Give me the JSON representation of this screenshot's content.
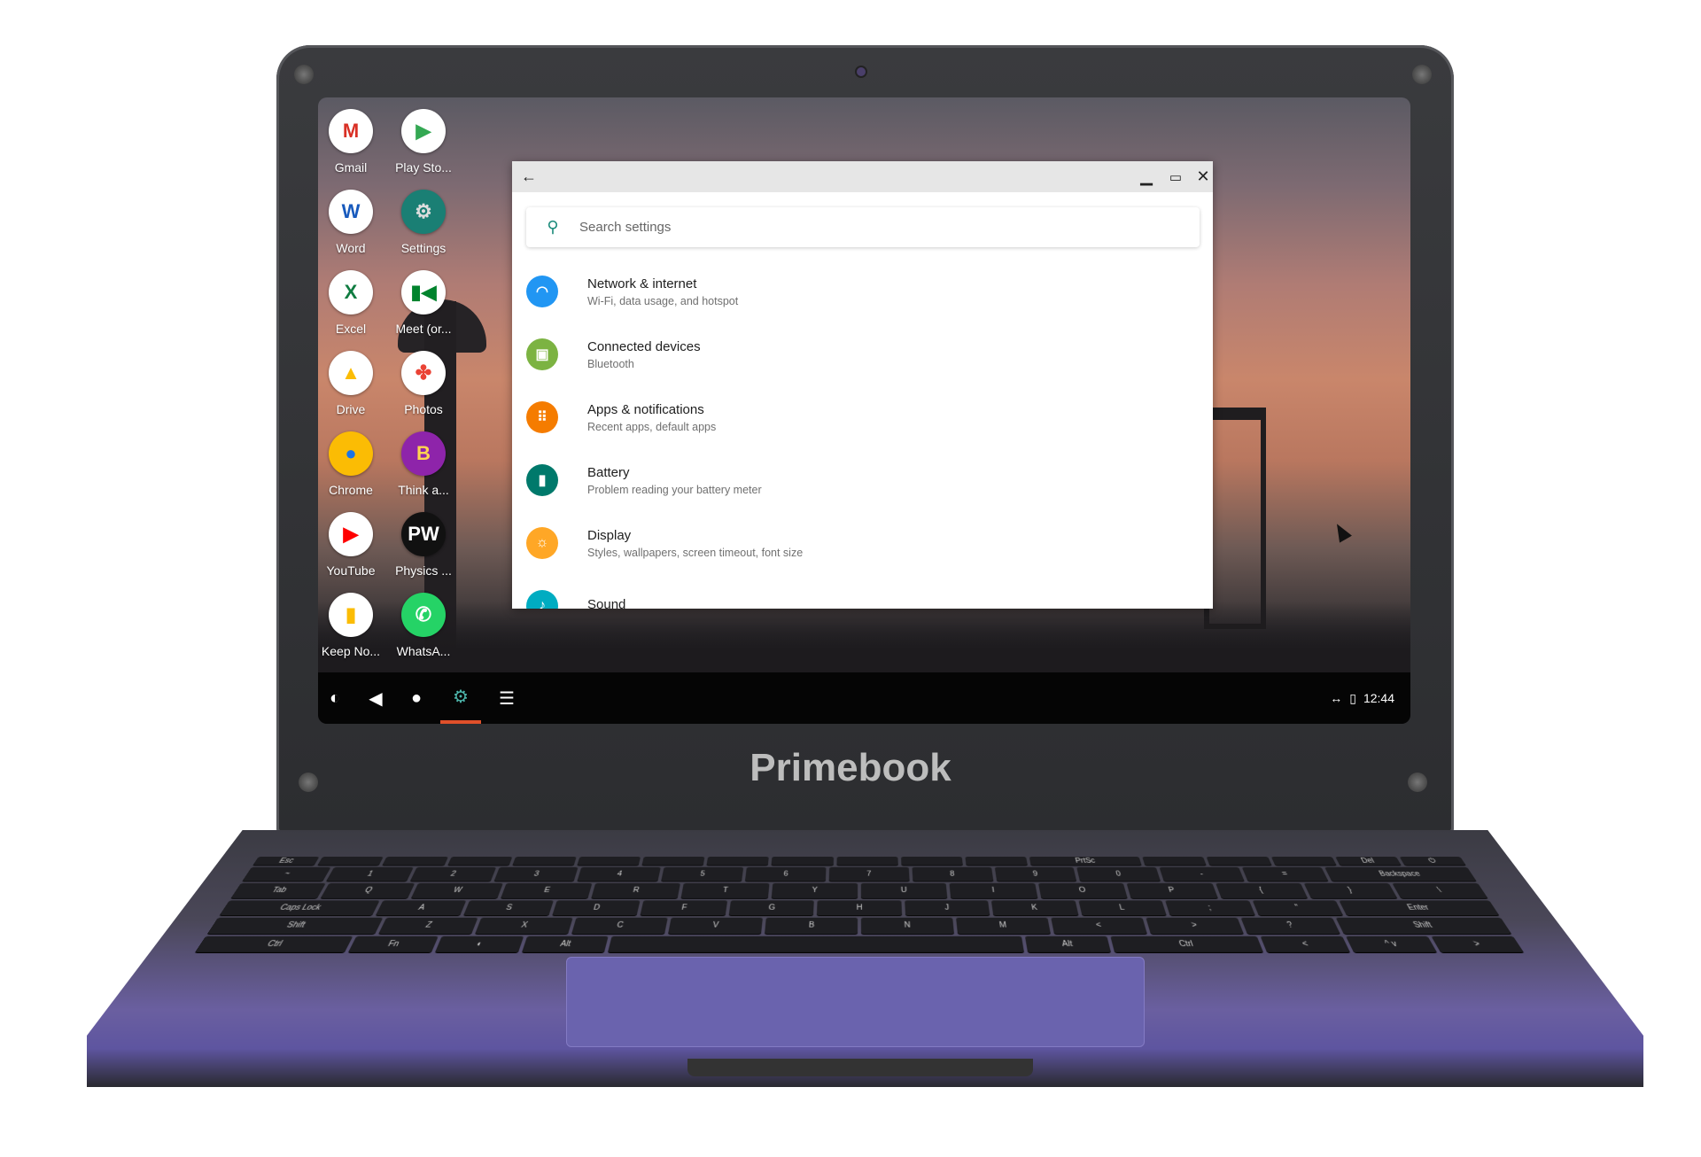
{
  "device": {
    "brand": "Primebook"
  },
  "desktop": {
    "apps": [
      {
        "label": "Gmail",
        "icon": "gmail-icon",
        "glyph": "M",
        "bg": "#ffffff",
        "fg": "#d93025"
      },
      {
        "label": "Play Sto...",
        "icon": "play-store-icon",
        "glyph": "▶",
        "bg": "#ffffff",
        "fg": "#34a853"
      },
      {
        "label": "Word",
        "icon": "word-icon",
        "glyph": "W",
        "bg": "#ffffff",
        "fg": "#185abd"
      },
      {
        "label": "Settings",
        "icon": "settings-gear-icon",
        "glyph": "⚙",
        "bg": "#1a7f74",
        "fg": "#dddddd"
      },
      {
        "label": "Excel",
        "icon": "excel-icon",
        "glyph": "X",
        "bg": "#ffffff",
        "fg": "#107c41"
      },
      {
        "label": "Meet (or...",
        "icon": "meet-icon",
        "glyph": "▮◀",
        "bg": "#ffffff",
        "fg": "#00832d"
      },
      {
        "label": "Drive",
        "icon": "drive-icon",
        "glyph": "▲",
        "bg": "#ffffff",
        "fg": "#fbbc04"
      },
      {
        "label": "Photos",
        "icon": "photos-icon",
        "glyph": "✤",
        "bg": "#ffffff",
        "fg": "#ea4335"
      },
      {
        "label": "Chrome",
        "icon": "chrome-icon",
        "glyph": "●",
        "bg": "#fbbc04",
        "fg": "#1a73e8"
      },
      {
        "label": "Think a...",
        "icon": "think-academy-icon",
        "glyph": "B",
        "bg": "#8e24aa",
        "fg": "#ffd54f"
      },
      {
        "label": "YouTube",
        "icon": "youtube-icon",
        "glyph": "▶",
        "bg": "#ffffff",
        "fg": "#ff0000"
      },
      {
        "label": "Physics ...",
        "icon": "physics-wallah-icon",
        "glyph": "PW",
        "bg": "#111111",
        "fg": "#ffffff"
      },
      {
        "label": "Keep No...",
        "icon": "keep-notes-icon",
        "glyph": "▮",
        "bg": "#ffffff",
        "fg": "#fbbc04"
      },
      {
        "label": "WhatsA...",
        "icon": "whatsapp-icon",
        "glyph": "✆",
        "bg": "#25d366",
        "fg": "#ffffff"
      }
    ]
  },
  "taskbar": {
    "items": [
      {
        "icon": "launcher-icon",
        "glyph": "◐"
      },
      {
        "icon": "back-icon",
        "glyph": "◀"
      },
      {
        "icon": "home-icon",
        "glyph": "●"
      },
      {
        "icon": "settings-app-icon",
        "glyph": "⚙",
        "active": true
      },
      {
        "icon": "recents-menu-icon",
        "glyph": "☰"
      }
    ],
    "status": {
      "network": "↔",
      "battery": "▯",
      "time": "12:44"
    },
    "active_color": "#e0502a"
  },
  "settings_window": {
    "search_placeholder": "Search settings",
    "items": [
      {
        "title": "Network & internet",
        "subtitle": "Wi-Fi, data usage, and hotspot",
        "icon": "wifi-icon",
        "glyph": "◠",
        "color": "#2196f3"
      },
      {
        "title": "Connected devices",
        "subtitle": "Bluetooth",
        "icon": "connected-devices-icon",
        "glyph": "▣",
        "color": "#7cb342"
      },
      {
        "title": "Apps & notifications",
        "subtitle": "Recent apps, default apps",
        "icon": "apps-grid-icon",
        "glyph": "⠿",
        "color": "#f57c00"
      },
      {
        "title": "Battery",
        "subtitle": "Problem reading your battery meter",
        "icon": "battery-icon",
        "glyph": "▮",
        "color": "#00796b"
      },
      {
        "title": "Display",
        "subtitle": "Styles, wallpapers, screen timeout, font size",
        "icon": "brightness-icon",
        "glyph": "☼",
        "color": "#ffa726"
      },
      {
        "title": "Sound",
        "subtitle": "",
        "icon": "volume-icon",
        "glyph": "♪",
        "color": "#00acc1"
      }
    ]
  },
  "keyboard": {
    "rows": [
      [
        "Esc",
        "",
        "",
        "",
        "",
        "",
        "",
        "",
        "",
        "",
        "",
        "",
        "PrtSc",
        "",
        "",
        "",
        "Del",
        "⏻"
      ],
      [
        "~",
        "1",
        "2",
        "3",
        "4",
        "5",
        "6",
        "7",
        "8",
        "9",
        "0",
        "-",
        "=",
        "Backspace"
      ],
      [
        "Tab",
        "Q",
        "W",
        "E",
        "R",
        "T",
        "Y",
        "U",
        "I",
        "O",
        "P",
        "{",
        "}",
        "\\"
      ],
      [
        "Caps Lock",
        "A",
        "S",
        "D",
        "F",
        "G",
        "H",
        "J",
        "K",
        "L",
        ";",
        "\"",
        "Enter"
      ],
      [
        "Shift",
        "Z",
        "X",
        "C",
        "V",
        "B",
        "N",
        "M",
        "<",
        ">",
        "?",
        "Shift"
      ],
      [
        "Ctrl",
        "Fn",
        "◐",
        "Alt",
        "",
        "Alt",
        "Ctrl",
        "<",
        "^ v",
        ">"
      ]
    ]
  }
}
